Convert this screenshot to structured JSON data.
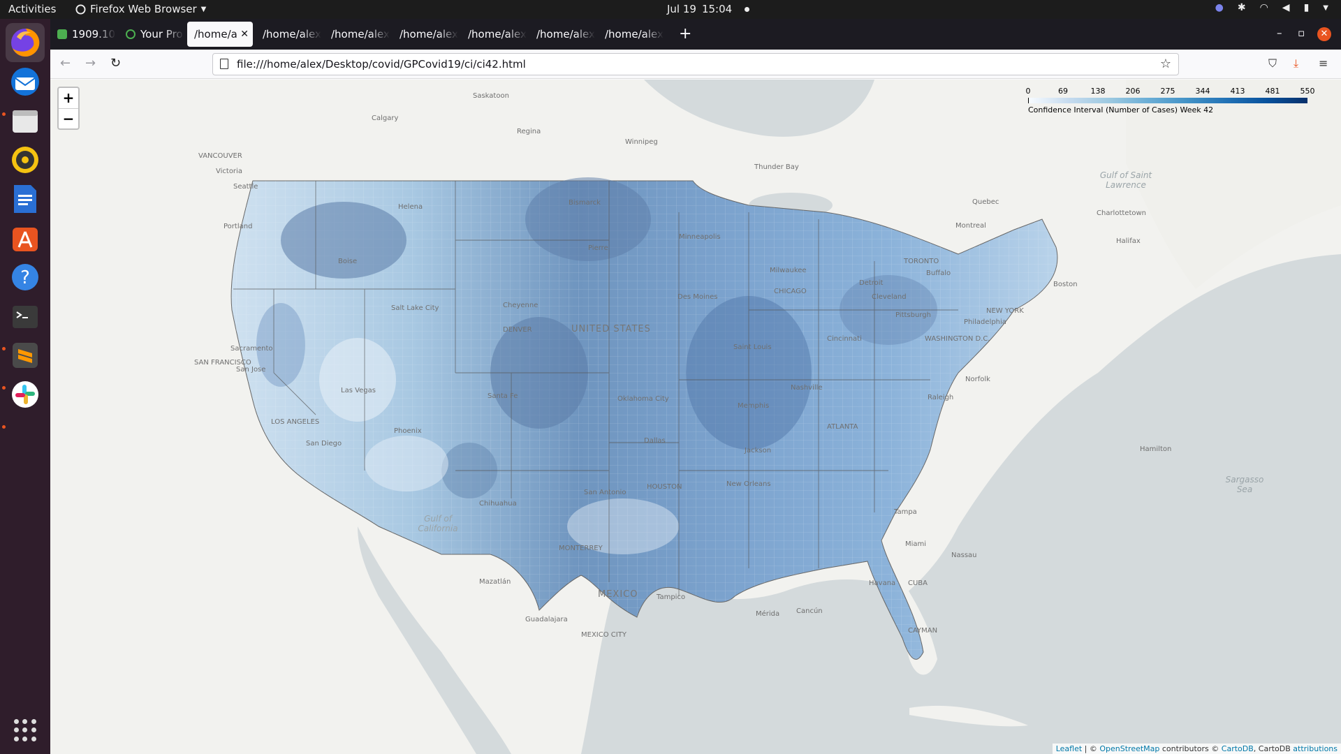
{
  "topbar": {
    "activities": "Activities",
    "app_name": "Firefox Web Browser",
    "date": "Jul 19",
    "time": "15:04"
  },
  "dock": {
    "items": [
      "firefox",
      "thunderbird",
      "files",
      "rhythmbox",
      "libreoffice-writer",
      "app-center",
      "help",
      "terminal",
      "sublime-text",
      "slack"
    ]
  },
  "tabs": [
    {
      "label": "1909.10"
    },
    {
      "label": "Your Pro"
    },
    {
      "label": "/home/a",
      "selected": true
    },
    {
      "label": "/home/alex"
    },
    {
      "label": "/home/alex"
    },
    {
      "label": "/home/alex"
    },
    {
      "label": "/home/alex"
    },
    {
      "label": "/home/alex"
    },
    {
      "label": "/home/alex"
    }
  ],
  "urlbar": {
    "url": "file:///home/alex/Desktop/covid/GPCovid19/ci/ci42.html"
  },
  "map": {
    "zoom_in": "+",
    "zoom_out": "−",
    "legend": {
      "ticks": [
        "0",
        "69",
        "138",
        "206",
        "275",
        "344",
        "413",
        "481",
        "550"
      ],
      "caption": "Confidence Interval (Number of Cases) Week 42",
      "min": 0,
      "max": 550,
      "colors": [
        "#f7fbff",
        "#c6dbef",
        "#9ecae1",
        "#6baed6",
        "#4292c6",
        "#2171b5",
        "#08519c",
        "#08306b"
      ]
    },
    "labels": {
      "saskatoon": "Saskatoon",
      "calgary": "Calgary",
      "regina": "Regina",
      "winnipeg": "Winnipeg",
      "vancouver": "VANCOUVER",
      "victoria": "Victoria",
      "seattle": "Seattle",
      "portland": "Portland",
      "thunder_bay": "Thunder Bay",
      "quebec": "Quebec",
      "montreal": "Montreal",
      "charlottetown": "Charlottetown",
      "halifax": "Halifax",
      "toronto": "TORONTO",
      "gulf_st_lawrence": "Gulf of Saint Lawrence",
      "helena": "Helena",
      "bismarck": "Bismarck",
      "pierre": "Pierre",
      "minneapolis": "Minneapolis",
      "boise": "Boise",
      "milwaukee": "Milwaukee",
      "chicago": "CHICAGO",
      "detroit": "Detroit",
      "buffalo": "Buffalo",
      "boston": "Boston",
      "new_york": "NEW YORK",
      "salt_lake": "Salt Lake City",
      "cheyenne": "Cheyenne",
      "des_moines": "Des Moines",
      "cleveland": "Cleveland",
      "pittsburgh": "Pittsburgh",
      "philadelphia": "Philadelphia",
      "denver": "DENVER",
      "united_states": "UNITED STATES",
      "washington": "WASHINGTON D.C.",
      "sacramento": "Sacramento",
      "san_francisco": "SAN FRANCISCO",
      "san_jose": "San Jose",
      "las_vegas": "Las Vegas",
      "saint_louis": "Saint Louis",
      "cincinnati": "Cincinnati",
      "norfolk": "Norfolk",
      "nashville": "Nashville",
      "raleigh": "Raleigh",
      "santa_fe": "Santa Fe",
      "oklahoma_city": "Oklahoma City",
      "memphis": "Memphis",
      "atlanta": "ATLANTA",
      "los_angeles": "LOS ANGELES",
      "san_diego": "San Diego",
      "phoenix": "Phoenix",
      "dallas": "Dallas",
      "jackson": "Jackson",
      "houston": "HOUSTON",
      "san_antonio": "San Antonio",
      "new_orleans": "New Orleans",
      "tampa": "Tampa",
      "miami": "Miami",
      "nassau": "Nassau",
      "hamilton": "Hamilton",
      "sargasso_sea": "Sargasso Sea",
      "chihuahua": "Chihuahua",
      "gulf_california": "Gulf of California",
      "monterrey": "MONTERREY",
      "mazatlan": "Mazatlán",
      "mexico": "MEXICO",
      "tampico": "Tampico",
      "merida": "Mérida",
      "cancun": "Cancún",
      "havana": "Havana",
      "cuba": "CUBA",
      "guadalajara": "Guadalajara",
      "mexico_city": "MEXICO CITY",
      "caymans": "CAYMAN"
    },
    "attribution": {
      "leaflet": "Leaflet",
      "sep1": " | © ",
      "osm": "OpenStreetMap",
      "contributors": " contributors © ",
      "cartodb": "CartoDB",
      "cartodb2": ", CartoDB ",
      "attributions": "attributions"
    }
  }
}
